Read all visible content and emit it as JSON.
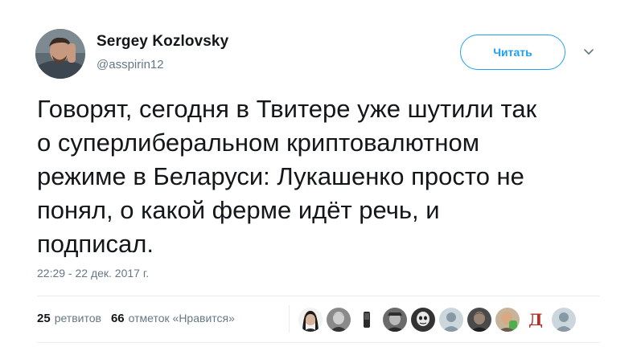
{
  "author": {
    "name": "Sergey Kozlovsky",
    "handle": "@asspirin12"
  },
  "follow_button": {
    "label": "Читать"
  },
  "tweet": {
    "text": "Говорят, сегодня в Твитере уже шутили так\nо суперлиберальном криптовалютном\nрежиме в Беларуси: Лукашенко просто не\nпонял, о какой ферме идёт речь, и\nподписал.",
    "timestamp": "22:29 - 22 дек. 2017 г."
  },
  "stats": {
    "retweets_count": "25",
    "retweets_label": "ретвитов",
    "likes_count": "66",
    "likes_label": "отметок «Нравится»"
  },
  "likers": [
    {
      "letter": ""
    },
    {
      "letter": ""
    },
    {
      "letter": ""
    },
    {
      "letter": ""
    },
    {
      "letter": ""
    },
    {
      "letter": ""
    },
    {
      "letter": ""
    },
    {
      "letter": ""
    },
    {
      "letter": "Д"
    },
    {
      "letter": ""
    }
  ],
  "colors": {
    "accent": "#1da1f2",
    "text_primary": "#14171a",
    "text_secondary": "#657786",
    "divider": "#e6ecf0"
  }
}
